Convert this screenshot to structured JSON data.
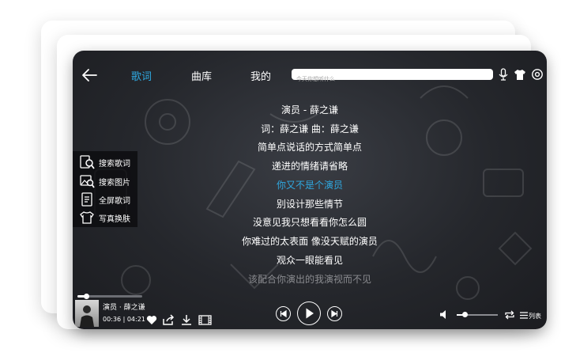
{
  "header": {
    "tabs": [
      {
        "label": "歌词",
        "active": true
      },
      {
        "label": "曲库",
        "active": false
      },
      {
        "label": "我的",
        "active": false
      }
    ],
    "search": {
      "placeholder": "今天你想听什么"
    },
    "icons": [
      "back-arrow-icon",
      "microphone-icon",
      "tshirt-icon",
      "settings-icon"
    ]
  },
  "lyrics": {
    "lines": [
      {
        "text": "演员 - 薛之谦",
        "state": "normal"
      },
      {
        "text": "词：薛之谦 曲：薛之谦",
        "state": "normal"
      },
      {
        "text": "简单点说话的方式简单点",
        "state": "normal"
      },
      {
        "text": "递进的情绪请省略",
        "state": "normal"
      },
      {
        "text": "你又不是个演员",
        "state": "current"
      },
      {
        "text": "别设计那些情节",
        "state": "normal"
      },
      {
        "text": "没意见我只想看看你怎么圆",
        "state": "normal"
      },
      {
        "text": "你难过的太表面 像没天赋的演员",
        "state": "normal"
      },
      {
        "text": "观众一眼能看见",
        "state": "normal"
      },
      {
        "text": "该配合你演出的我演视而不见",
        "state": "fade"
      }
    ],
    "current_color": "#2fa8e0"
  },
  "side_menu": {
    "items": [
      {
        "label": "搜索歌词",
        "icon": "search-lyrics-icon"
      },
      {
        "label": "搜索图片",
        "icon": "search-image-icon"
      },
      {
        "label": "全屏歌词",
        "icon": "fullscreen-lyrics-icon"
      },
      {
        "label": "写真换肤",
        "icon": "skin-tshirt-icon"
      }
    ]
  },
  "player": {
    "title": "演员 · 薛之谦",
    "time": "00:36 | 04:21",
    "progress": 0.138,
    "volume": 0.2,
    "playlist_label": "列表",
    "icons": [
      "heart-icon",
      "share-icon",
      "download-icon",
      "mv-icon",
      "previous-icon",
      "play-icon",
      "next-icon",
      "volume-icon",
      "loop-icon",
      "playlist-icon"
    ]
  }
}
